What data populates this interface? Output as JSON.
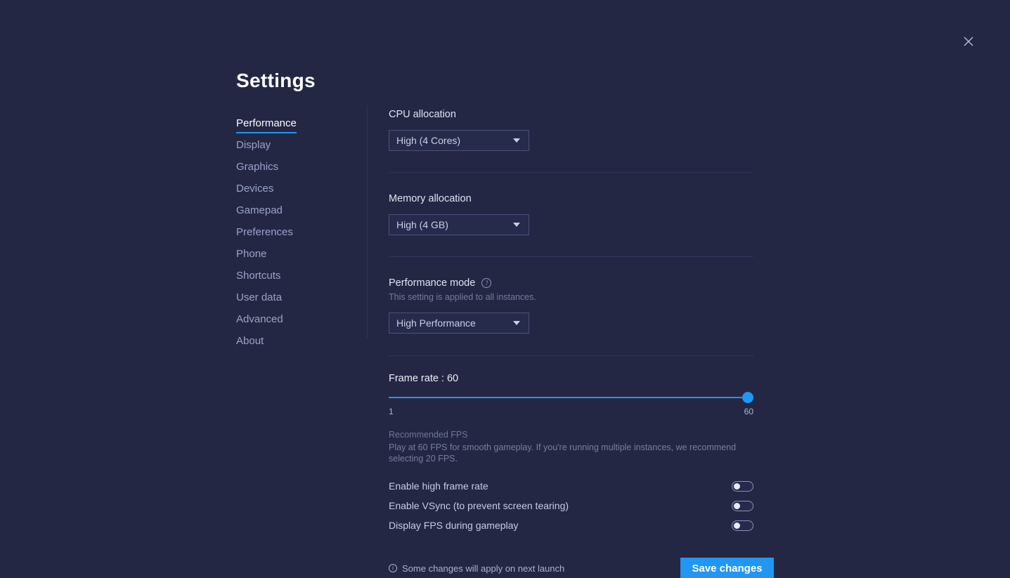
{
  "window": {
    "title": "Settings",
    "close_icon": "close-icon"
  },
  "sidebar": {
    "items": [
      {
        "label": "Performance",
        "active": true
      },
      {
        "label": "Display",
        "active": false
      },
      {
        "label": "Graphics",
        "active": false
      },
      {
        "label": "Devices",
        "active": false
      },
      {
        "label": "Gamepad",
        "active": false
      },
      {
        "label": "Preferences",
        "active": false
      },
      {
        "label": "Phone",
        "active": false
      },
      {
        "label": "Shortcuts",
        "active": false
      },
      {
        "label": "User data",
        "active": false
      },
      {
        "label": "Advanced",
        "active": false
      },
      {
        "label": "About",
        "active": false
      }
    ]
  },
  "content": {
    "cpu": {
      "label": "CPU allocation",
      "value": "High (4 Cores)"
    },
    "memory": {
      "label": "Memory allocation",
      "value": "High (4 GB)"
    },
    "performance_mode": {
      "label": "Performance mode",
      "help_icon": "question-mark-icon",
      "note": "This setting is applied to all instances.",
      "value": "High Performance"
    },
    "frame_rate": {
      "title": "Frame rate : 60",
      "value": 60,
      "min_label": "1",
      "max_label": "60",
      "min": 1,
      "max": 60,
      "recommended_title": "Recommended FPS",
      "recommended_text": "Play at 60 FPS for smooth gameplay. If you're running multiple instances, we recommend selecting 20 FPS."
    },
    "toggles": [
      {
        "label": "Enable high frame rate",
        "on": false
      },
      {
        "label": "Enable VSync (to prevent screen tearing)",
        "on": false
      },
      {
        "label": "Display FPS during gameplay",
        "on": false
      }
    ],
    "footer": {
      "info_icon": "info-icon",
      "note": "Some changes will apply on next launch",
      "save_label": "Save changes"
    }
  },
  "colors": {
    "background": "#232744",
    "accent": "#2196f3",
    "text_primary": "#ffffff",
    "text_secondary": "#9ba3c7",
    "text_muted": "#737b9e",
    "divider": "#2f3459",
    "field_bg": "#262b4b",
    "field_border": "#4b5279"
  }
}
